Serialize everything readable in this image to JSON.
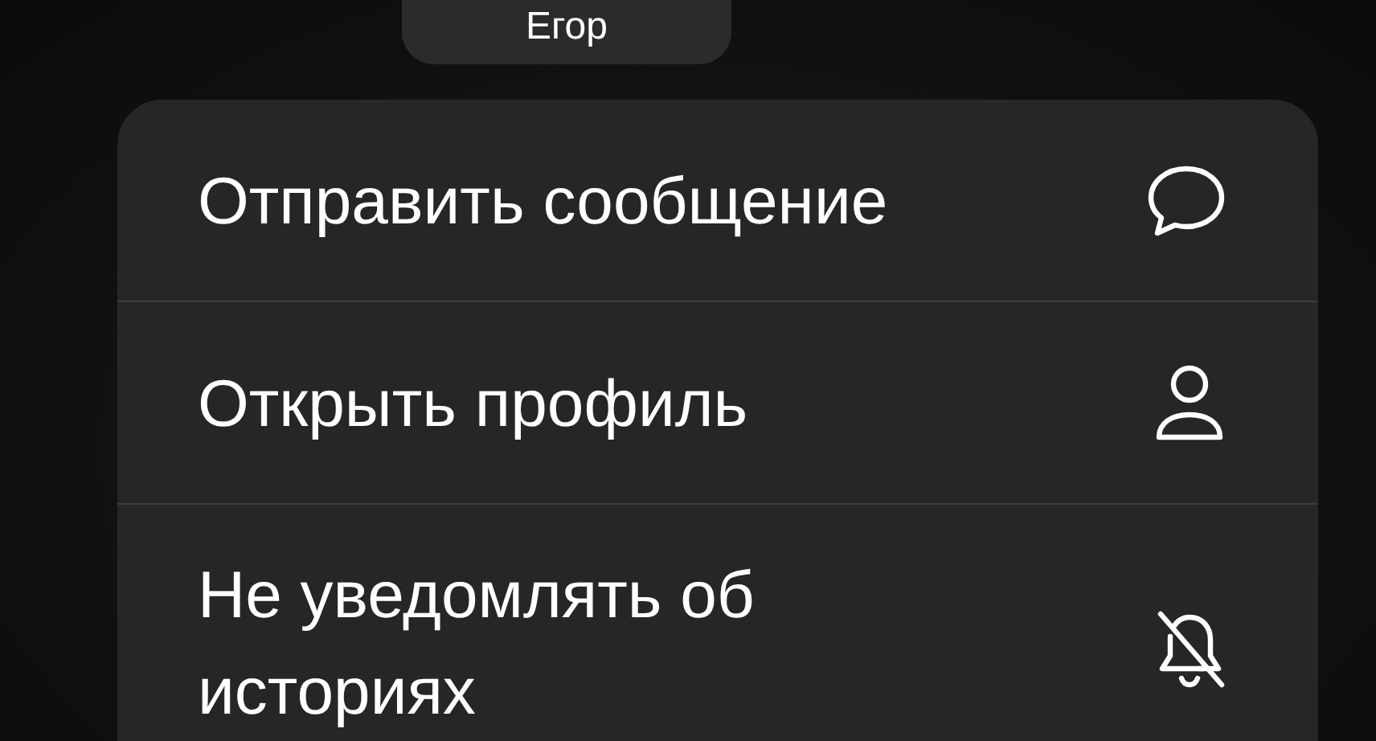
{
  "contact": {
    "name": "Егор"
  },
  "menu": [
    {
      "label": "Отправить сообщение",
      "kind": "message"
    },
    {
      "label": "Открыть профиль",
      "kind": "profile"
    },
    {
      "label": "Не уведомлять об историях",
      "kind": "mute"
    }
  ]
}
